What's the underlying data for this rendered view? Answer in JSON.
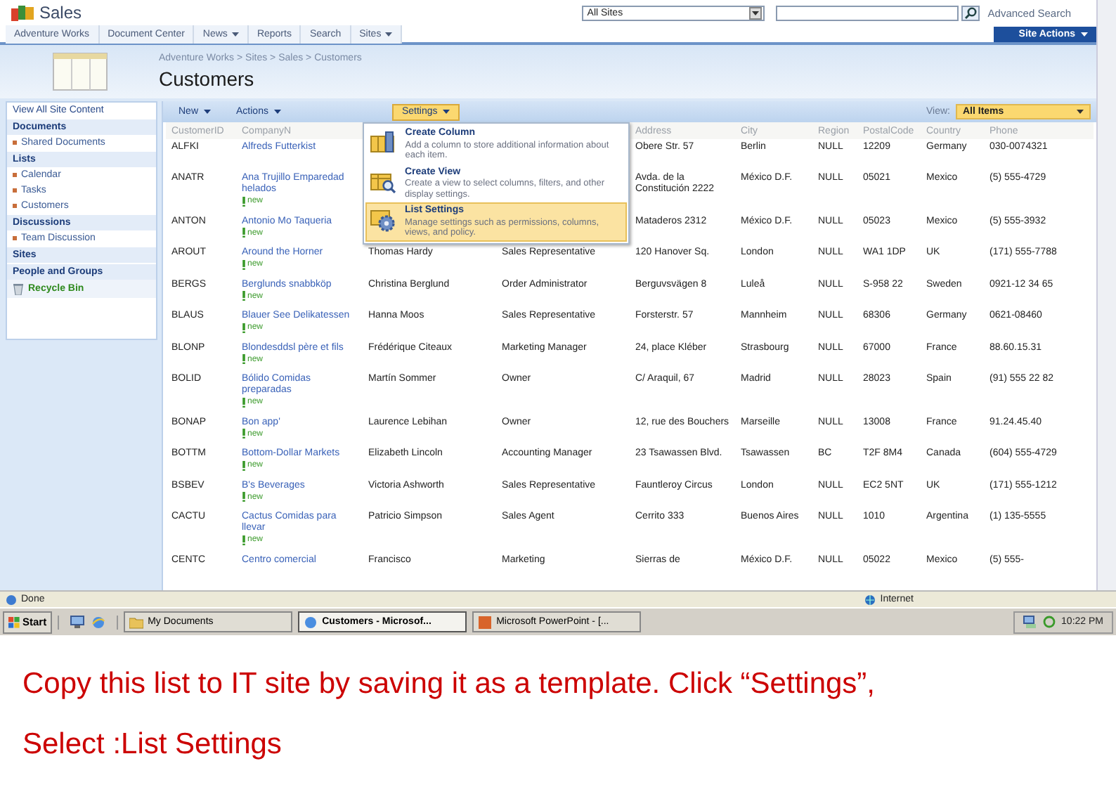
{
  "site": {
    "title": "Sales",
    "search_scope": "All Sites",
    "advanced_search": "Advanced Search",
    "site_actions": "Site Actions"
  },
  "nav": [
    {
      "label": "Adventure Works",
      "dropdown": false
    },
    {
      "label": "Document Center",
      "dropdown": false
    },
    {
      "label": "News",
      "dropdown": true
    },
    {
      "label": "Reports",
      "dropdown": false
    },
    {
      "label": "Search",
      "dropdown": false
    },
    {
      "label": "Sites",
      "dropdown": true
    }
  ],
  "breadcrumb": "Adventure Works > Sites > Sales > Customers",
  "page_title": "Customers",
  "quick_launch": [
    {
      "kind": "link",
      "label": "View All Site Content"
    },
    {
      "kind": "heading",
      "label": "Documents"
    },
    {
      "kind": "item",
      "label": "Shared Documents"
    },
    {
      "kind": "heading",
      "label": "Lists"
    },
    {
      "kind": "item",
      "label": "Calendar"
    },
    {
      "kind": "item",
      "label": "Tasks"
    },
    {
      "kind": "item",
      "label": "Customers"
    },
    {
      "kind": "heading",
      "label": "Discussions"
    },
    {
      "kind": "item",
      "label": "Team Discussion"
    },
    {
      "kind": "heading",
      "label": "Sites"
    },
    {
      "kind": "heading",
      "label": "People and Groups"
    },
    {
      "kind": "recycle",
      "label": "Recycle Bin"
    }
  ],
  "toolbar": {
    "menus": [
      {
        "label": "New",
        "selected": false
      },
      {
        "label": "Actions",
        "selected": false
      },
      {
        "label": "Settings",
        "selected": true
      }
    ],
    "view_label": "View:",
    "view": "All Items"
  },
  "settings_menu": [
    {
      "kind": "column",
      "title": "Create Column",
      "description": "Add a column to store additional information about each item.",
      "selected": false
    },
    {
      "kind": "view",
      "title": "Create View",
      "description": "Create a view to select columns, filters, and other display settings.",
      "selected": false
    },
    {
      "kind": "settings",
      "title": "List Settings",
      "description": "Manage settings such as permissions, columns, views, and policy.",
      "selected": true
    }
  ],
  "table": {
    "columns": [
      "CustomerID",
      "CompanyN",
      null,
      null,
      "Address",
      "City",
      "Region",
      "PostalCode",
      "Country",
      "Phone"
    ],
    "rows": [
      {
        "cells": [
          "ALFKI",
          "Alfreds Futterkist",
          null,
          null,
          "Obere Str. 57",
          "Berlin",
          "NULL",
          "12209",
          "Germany",
          "030-0074321"
        ]
      },
      {
        "cells": [
          "ANATR",
          "Ana Trujillo Emparedad helados",
          null,
          null,
          "Avda. de la Constitución 2222",
          "México D.F.",
          "NULL",
          "05021",
          "Mexico",
          "(5) 555-4729"
        ],
        "badge": "new"
      },
      {
        "cells": [
          "ANTON",
          "Antonio Mo Taqueria",
          null,
          null,
          "Mataderos 2312",
          "México D.F.",
          "NULL",
          "05023",
          "Mexico",
          "(5) 555-3932"
        ],
        "badge": "new"
      },
      {
        "cells": [
          "AROUT",
          "Around the Horner",
          "Thomas Hardy",
          "Sales Representative",
          "120 Hanover Sq.",
          "London",
          "NULL",
          "WA1 1DP",
          "UK",
          "(171) 555-7788"
        ],
        "badge": "new"
      },
      {
        "cells": [
          "BERGS",
          "Berglunds snabbköp",
          "Christina Berglund",
          "Order Administrator",
          "Berguvsvägen 8",
          "Luleå",
          "NULL",
          "S-958 22",
          "Sweden",
          "0921-12 34 65"
        ],
        "badge": "new"
      },
      {
        "cells": [
          "BLAUS",
          "Blauer See Delikatessen",
          "Hanna Moos",
          "Sales Representative",
          "Forsterstr. 57",
          "Mannheim",
          "NULL",
          "68306",
          "Germany",
          "0621-08460"
        ],
        "badge": "new"
      },
      {
        "cells": [
          "BLONP",
          "Blondesddsl père et fils",
          "Frédérique Citeaux",
          "Marketing Manager",
          "24, place Kléber",
          "Strasbourg",
          "NULL",
          "67000",
          "France",
          "88.60.15.31"
        ],
        "badge": "new"
      },
      {
        "cells": [
          "BOLID",
          "Bólido Comidas preparadas",
          "Martín Sommer",
          "Owner",
          "C/ Araquil, 67",
          "Madrid",
          "NULL",
          "28023",
          "Spain",
          "(91) 555 22 82"
        ],
        "badge": "new"
      },
      {
        "cells": [
          "BONAP",
          "Bon app'",
          "Laurence Lebihan",
          "Owner",
          "12, rue des Bouchers",
          "Marseille",
          "NULL",
          "13008",
          "France",
          "91.24.45.40"
        ],
        "badge": "new"
      },
      {
        "cells": [
          "BOTTM",
          "Bottom-Dollar Markets",
          "Elizabeth Lincoln",
          "Accounting Manager",
          "23 Tsawassen Blvd.",
          "Tsawassen",
          "BC",
          "T2F 8M4",
          "Canada",
          "(604) 555-4729"
        ],
        "badge": "new"
      },
      {
        "cells": [
          "BSBEV",
          "B's Beverages",
          "Victoria Ashworth",
          "Sales Representative",
          "Fauntleroy Circus",
          "London",
          "NULL",
          "EC2 5NT",
          "UK",
          "(171) 555-1212"
        ],
        "badge": "new"
      },
      {
        "cells": [
          "CACTU",
          "Cactus Comidas para llevar",
          "Patricio Simpson",
          "Sales Agent",
          "Cerrito 333",
          "Buenos Aires",
          "NULL",
          "1010",
          "Argentina",
          "(1) 135-5555"
        ],
        "badge": "new"
      },
      {
        "cells": [
          "CENTC",
          "Centro comercial",
          "Francisco",
          "Marketing",
          "Sierras de",
          "México D.F.",
          "NULL",
          "05022",
          "Mexico",
          "(5) 555-"
        ]
      }
    ]
  },
  "status_bar": {
    "left": "Done",
    "right": "Internet"
  },
  "taskbar": {
    "start": "Start",
    "windows": [
      {
        "label": "My Documents",
        "selected": false
      },
      {
        "label": "Customers - Microsof...",
        "selected": true
      },
      {
        "label": "Microsoft PowerPoint - [...",
        "selected": false
      }
    ],
    "clock": "10:22 PM"
  },
  "caption": [
    "Copy this list to IT site by saving it as a template. Click “Settings”,",
    "Select :List Settings"
  ]
}
